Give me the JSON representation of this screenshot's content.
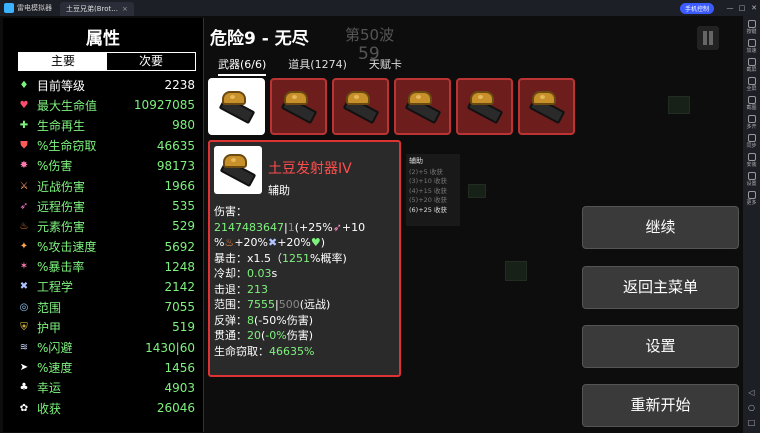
{
  "window": {
    "app_name": "雷电模拟器",
    "tab_title": "土豆兄弟(Brot...",
    "tab_close": "×",
    "pill": "手机控制",
    "controls": [
      "—",
      "□",
      "✕"
    ]
  },
  "emulator_toolbar": {
    "items": [
      "按键",
      "加速",
      "截屏",
      "全屏",
      "截图",
      "多开",
      "同步",
      "安装",
      "设置",
      "更多"
    ],
    "bottom": [
      "◁",
      "○",
      "□"
    ]
  },
  "game": {
    "title": "危险9 - 无尽",
    "wave_label": "第50波",
    "wave_number": "59",
    "tabs": [
      {
        "label": "武器(6/6)",
        "active": true
      },
      {
        "label": "道具(1274)",
        "active": false
      },
      {
        "label": "天赋卡",
        "active": false
      }
    ]
  },
  "attributes": {
    "title": "属性",
    "tabs": [
      {
        "label": "主要",
        "active": true
      },
      {
        "label": "次要",
        "active": false
      }
    ],
    "stats": [
      {
        "icon": "level-icon",
        "glyph": "♦",
        "color": "#ffffff",
        "icon_color": "#7ef27e",
        "label": "目前等级",
        "value": "2238"
      },
      {
        "icon": "heart-icon",
        "glyph": "♥",
        "color": "#7ef27e",
        "icon_color": "#ff4d6d",
        "label": "最大生命值",
        "value": "10927085"
      },
      {
        "icon": "regen-icon",
        "glyph": "✚",
        "color": "#7ef27e",
        "icon_color": "#7ef27e",
        "label": "生命再生",
        "value": "980"
      },
      {
        "icon": "lifesteal-icon",
        "glyph": "⛊",
        "color": "#7ef27e",
        "icon_color": "#ff5a5a",
        "label": "%生命窃取",
        "value": "46635"
      },
      {
        "icon": "damage-icon",
        "glyph": "✸",
        "color": "#7ef27e",
        "icon_color": "#ff7ab0",
        "label": "%伤害",
        "value": "98173"
      },
      {
        "icon": "melee-icon",
        "glyph": "⚔",
        "color": "#7ef27e",
        "icon_color": "#ff9a6b",
        "label": "近战伤害",
        "value": "1966"
      },
      {
        "icon": "ranged-icon",
        "glyph": "➶",
        "color": "#7ef27e",
        "icon_color": "#ff7ad2",
        "label": "远程伤害",
        "value": "535"
      },
      {
        "icon": "elemental-icon",
        "glyph": "♨",
        "color": "#7ef27e",
        "icon_color": "#ff8a3d",
        "label": "元素伤害",
        "value": "529"
      },
      {
        "icon": "attack-speed-icon",
        "glyph": "✦",
        "color": "#7ef27e",
        "icon_color": "#ffa64d",
        "label": "%攻击速度",
        "value": "5692"
      },
      {
        "icon": "crit-icon",
        "glyph": "✶",
        "color": "#7ef27e",
        "icon_color": "#ff7ab0",
        "label": "%暴击率",
        "value": "1248"
      },
      {
        "icon": "engineering-icon",
        "glyph": "✖",
        "color": "#7ef27e",
        "icon_color": "#b0c4ff",
        "label": "工程学",
        "value": "2142"
      },
      {
        "icon": "range-icon",
        "glyph": "◎",
        "color": "#7ef27e",
        "icon_color": "#9ad0ff",
        "label": "范围",
        "value": "7055"
      },
      {
        "icon": "armor-icon",
        "glyph": "⛨",
        "color": "#7ef27e",
        "icon_color": "#ffd84d",
        "label": "护甲",
        "value": "519"
      },
      {
        "icon": "dodge-icon",
        "glyph": "≋",
        "color": "#7ef27e",
        "icon_color": "#cfd8ff",
        "label": "%闪避",
        "value": "1430|60"
      },
      {
        "icon": "speed-icon",
        "glyph": "➤",
        "color": "#7ef27e",
        "icon_color": "#ffffff",
        "label": "%速度",
        "value": "1456"
      },
      {
        "icon": "luck-icon",
        "glyph": "♣",
        "color": "#7ef27e",
        "icon_color": "#ffffff",
        "label": "幸运",
        "value": "4903"
      },
      {
        "icon": "harvesting-icon",
        "glyph": "✿",
        "color": "#7ef27e",
        "icon_color": "#ffffff",
        "label": "收获",
        "value": "26046"
      }
    ]
  },
  "weapon_detail": {
    "name": "土豆发射器IV",
    "type": "辅助",
    "damage_label": "伤害：",
    "damage_value": "2147483647",
    "damage_sep": "|",
    "damage_base": "1",
    "damage_scaling_1": "(+25%",
    "damage_scaling_2": "+10",
    "damage_scaling_3": "%",
    "damage_scaling_4": "+20%",
    "damage_scaling_5": "+20%",
    "damage_scaling_6": ")",
    "crit_label": "暴击：",
    "crit_mult": "x1.5",
    "crit_open": "（",
    "crit_value": "1251",
    "crit_suffix": "%概率)",
    "cooldown_label": "冷却：",
    "cooldown_value": "0.03",
    "cooldown_unit": "s",
    "knockback_label": "击退：",
    "knockback_value": "213",
    "range_label": "范围：",
    "range_value": "7555",
    "range_sep": "|",
    "range_base": "500",
    "range_suffix": "(远战)",
    "bounce_label": "反弹：",
    "bounce_value": "8",
    "bounce_suffix": "(-50%伤害)",
    "pierce_label": "贯通：",
    "pierce_value": "20",
    "pierce_open": "(",
    "pierce_pct": "-0%",
    "pierce_suffix": "伤害)",
    "lifesteal_label": "生命窃取：",
    "lifesteal_value": "46635%"
  },
  "aux_box": {
    "title": "辅助",
    "lines": [
      {
        "text": "(2)+5 收获",
        "on": false
      },
      {
        "text": "(3)+10 收获",
        "on": false
      },
      {
        "text": "(4)+15 收获",
        "on": false
      },
      {
        "text": "(5)+20 收获",
        "on": false
      },
      {
        "text": "(6)+25 收获",
        "on": true
      }
    ]
  },
  "menu": {
    "continue": "继续",
    "main_menu": "返回主菜单",
    "settings": "设置",
    "restart": "重新开始"
  }
}
